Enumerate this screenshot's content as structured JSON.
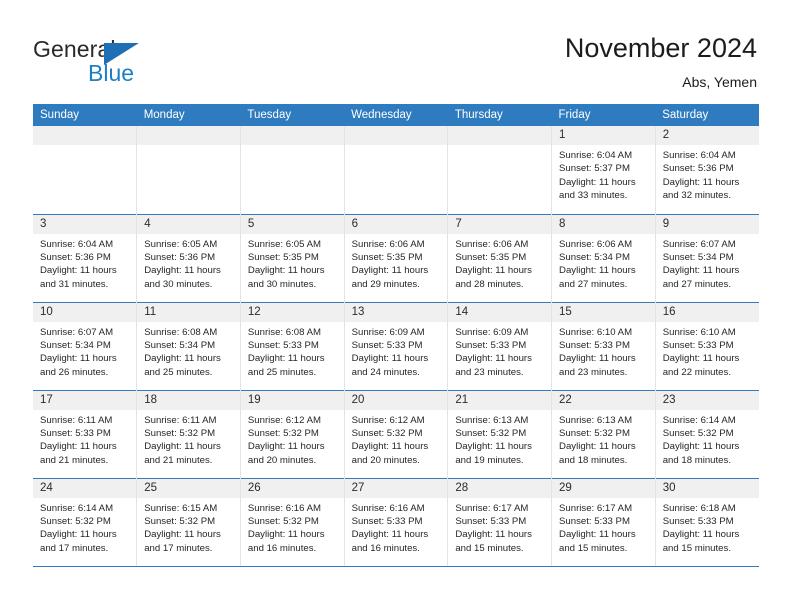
{
  "brand": {
    "name_part1": "General",
    "name_part2": "Blue",
    "triangle_icon": "blue-triangle-icon",
    "accent_color": "#1f7fc4"
  },
  "header": {
    "title": "November 2024",
    "subtitle": "Abs, Yemen"
  },
  "theme": {
    "header_row_bg": "#2f7bbf",
    "day_strip_bg": "#f0f0f0",
    "rule_color": "#2f7bbf"
  },
  "weekday_headers": [
    "Sunday",
    "Monday",
    "Tuesday",
    "Wednesday",
    "Thursday",
    "Friday",
    "Saturday"
  ],
  "weeks": [
    [
      {
        "day": "",
        "lines": []
      },
      {
        "day": "",
        "lines": []
      },
      {
        "day": "",
        "lines": []
      },
      {
        "day": "",
        "lines": []
      },
      {
        "day": "",
        "lines": []
      },
      {
        "day": "1",
        "lines": [
          "Sunrise: 6:04 AM",
          "Sunset: 5:37 PM",
          "Daylight: 11 hours",
          "and 33 minutes."
        ]
      },
      {
        "day": "2",
        "lines": [
          "Sunrise: 6:04 AM",
          "Sunset: 5:36 PM",
          "Daylight: 11 hours",
          "and 32 minutes."
        ]
      }
    ],
    [
      {
        "day": "3",
        "lines": [
          "Sunrise: 6:04 AM",
          "Sunset: 5:36 PM",
          "Daylight: 11 hours",
          "and 31 minutes."
        ]
      },
      {
        "day": "4",
        "lines": [
          "Sunrise: 6:05 AM",
          "Sunset: 5:36 PM",
          "Daylight: 11 hours",
          "and 30 minutes."
        ]
      },
      {
        "day": "5",
        "lines": [
          "Sunrise: 6:05 AM",
          "Sunset: 5:35 PM",
          "Daylight: 11 hours",
          "and 30 minutes."
        ]
      },
      {
        "day": "6",
        "lines": [
          "Sunrise: 6:06 AM",
          "Sunset: 5:35 PM",
          "Daylight: 11 hours",
          "and 29 minutes."
        ]
      },
      {
        "day": "7",
        "lines": [
          "Sunrise: 6:06 AM",
          "Sunset: 5:35 PM",
          "Daylight: 11 hours",
          "and 28 minutes."
        ]
      },
      {
        "day": "8",
        "lines": [
          "Sunrise: 6:06 AM",
          "Sunset: 5:34 PM",
          "Daylight: 11 hours",
          "and 27 minutes."
        ]
      },
      {
        "day": "9",
        "lines": [
          "Sunrise: 6:07 AM",
          "Sunset: 5:34 PM",
          "Daylight: 11 hours",
          "and 27 minutes."
        ]
      }
    ],
    [
      {
        "day": "10",
        "lines": [
          "Sunrise: 6:07 AM",
          "Sunset: 5:34 PM",
          "Daylight: 11 hours",
          "and 26 minutes."
        ]
      },
      {
        "day": "11",
        "lines": [
          "Sunrise: 6:08 AM",
          "Sunset: 5:34 PM",
          "Daylight: 11 hours",
          "and 25 minutes."
        ]
      },
      {
        "day": "12",
        "lines": [
          "Sunrise: 6:08 AM",
          "Sunset: 5:33 PM",
          "Daylight: 11 hours",
          "and 25 minutes."
        ]
      },
      {
        "day": "13",
        "lines": [
          "Sunrise: 6:09 AM",
          "Sunset: 5:33 PM",
          "Daylight: 11 hours",
          "and 24 minutes."
        ]
      },
      {
        "day": "14",
        "lines": [
          "Sunrise: 6:09 AM",
          "Sunset: 5:33 PM",
          "Daylight: 11 hours",
          "and 23 minutes."
        ]
      },
      {
        "day": "15",
        "lines": [
          "Sunrise: 6:10 AM",
          "Sunset: 5:33 PM",
          "Daylight: 11 hours",
          "and 23 minutes."
        ]
      },
      {
        "day": "16",
        "lines": [
          "Sunrise: 6:10 AM",
          "Sunset: 5:33 PM",
          "Daylight: 11 hours",
          "and 22 minutes."
        ]
      }
    ],
    [
      {
        "day": "17",
        "lines": [
          "Sunrise: 6:11 AM",
          "Sunset: 5:33 PM",
          "Daylight: 11 hours",
          "and 21 minutes."
        ]
      },
      {
        "day": "18",
        "lines": [
          "Sunrise: 6:11 AM",
          "Sunset: 5:32 PM",
          "Daylight: 11 hours",
          "and 21 minutes."
        ]
      },
      {
        "day": "19",
        "lines": [
          "Sunrise: 6:12 AM",
          "Sunset: 5:32 PM",
          "Daylight: 11 hours",
          "and 20 minutes."
        ]
      },
      {
        "day": "20",
        "lines": [
          "Sunrise: 6:12 AM",
          "Sunset: 5:32 PM",
          "Daylight: 11 hours",
          "and 20 minutes."
        ]
      },
      {
        "day": "21",
        "lines": [
          "Sunrise: 6:13 AM",
          "Sunset: 5:32 PM",
          "Daylight: 11 hours",
          "and 19 minutes."
        ]
      },
      {
        "day": "22",
        "lines": [
          "Sunrise: 6:13 AM",
          "Sunset: 5:32 PM",
          "Daylight: 11 hours",
          "and 18 minutes."
        ]
      },
      {
        "day": "23",
        "lines": [
          "Sunrise: 6:14 AM",
          "Sunset: 5:32 PM",
          "Daylight: 11 hours",
          "and 18 minutes."
        ]
      }
    ],
    [
      {
        "day": "24",
        "lines": [
          "Sunrise: 6:14 AM",
          "Sunset: 5:32 PM",
          "Daylight: 11 hours",
          "and 17 minutes."
        ]
      },
      {
        "day": "25",
        "lines": [
          "Sunrise: 6:15 AM",
          "Sunset: 5:32 PM",
          "Daylight: 11 hours",
          "and 17 minutes."
        ]
      },
      {
        "day": "26",
        "lines": [
          "Sunrise: 6:16 AM",
          "Sunset: 5:32 PM",
          "Daylight: 11 hours",
          "and 16 minutes."
        ]
      },
      {
        "day": "27",
        "lines": [
          "Sunrise: 6:16 AM",
          "Sunset: 5:33 PM",
          "Daylight: 11 hours",
          "and 16 minutes."
        ]
      },
      {
        "day": "28",
        "lines": [
          "Sunrise: 6:17 AM",
          "Sunset: 5:33 PM",
          "Daylight: 11 hours",
          "and 15 minutes."
        ]
      },
      {
        "day": "29",
        "lines": [
          "Sunrise: 6:17 AM",
          "Sunset: 5:33 PM",
          "Daylight: 11 hours",
          "and 15 minutes."
        ]
      },
      {
        "day": "30",
        "lines": [
          "Sunrise: 6:18 AM",
          "Sunset: 5:33 PM",
          "Daylight: 11 hours",
          "and 15 minutes."
        ]
      }
    ]
  ]
}
